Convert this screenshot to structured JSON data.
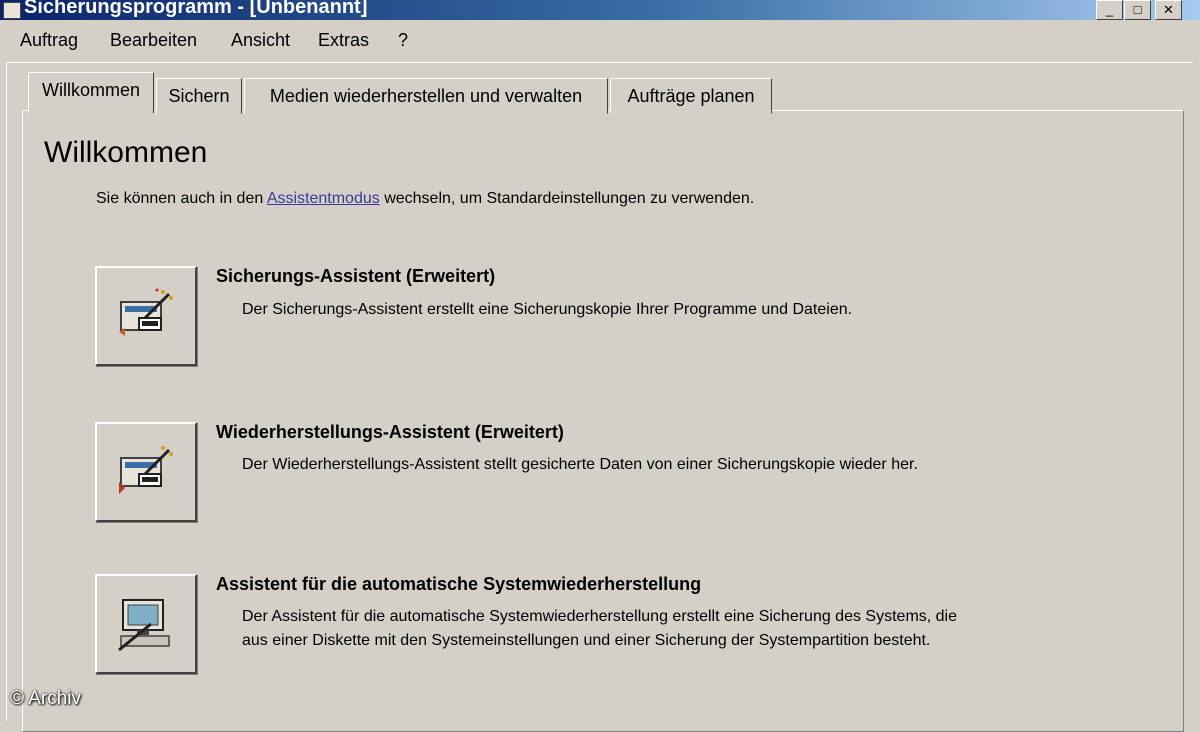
{
  "window": {
    "title": "Sicherungsprogramm - [Unbenannt]"
  },
  "window_controls": {
    "minimize": "_",
    "maximize": "□",
    "close": "✕"
  },
  "menu": {
    "items": [
      "Auftrag",
      "Bearbeiten",
      "Ansicht",
      "Extras",
      "?"
    ]
  },
  "tabs": [
    {
      "label": "Willkommen",
      "active": true
    },
    {
      "label": "Sichern"
    },
    {
      "label": "Medien wiederherstellen und verwalten"
    },
    {
      "label": "Aufträge planen"
    }
  ],
  "welcome": {
    "heading": "Willkommen",
    "intro_before": "Sie können auch in den ",
    "intro_link": "Assistentmodus",
    "intro_after": " wechseln, um Standardeinstellungen zu verwenden."
  },
  "wizards": [
    {
      "title": "Sicherungs-Assistent (Erweitert)",
      "icon": "backup-wizard-icon",
      "description": [
        "Der Sicherungs-Assistent erstellt eine Sicherungskopie Ihrer Programme und Dateien."
      ]
    },
    {
      "title": "Wiederherstellungs-Assistent (Erweitert)",
      "icon": "restore-wizard-icon",
      "description": [
        "Der Wiederherstellungs-Assistent stellt gesicherte Daten von einer Sicherungskopie wieder her."
      ]
    },
    {
      "title": "Assistent für die automatische Systemwiederherstellung",
      "icon": "system-recovery-wizard-icon",
      "description": [
        "Der Assistent für die automatische Systemwiederherstellung erstellt eine Sicherung des Systems, die",
        "aus einer Diskette mit den Systemeinstellungen und einer Sicherung der Systempartition besteht."
      ]
    }
  ],
  "watermark": "© Archiv",
  "colors": {
    "titlebar": "#0a246a",
    "window_bg": "#d4d0c8",
    "link": "#3b3b9a"
  }
}
